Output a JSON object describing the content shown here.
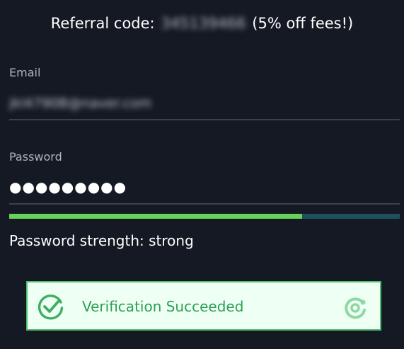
{
  "referral": {
    "prefix": "Referral code:",
    "code": "345139466",
    "suffix": "(5% off fees!)"
  },
  "email": {
    "label": "Email",
    "value": "jkl4790B@naver.com"
  },
  "password": {
    "label": "Password",
    "value": "●●●●●●●●●",
    "strength_fraction": 0.75,
    "strength_text": "Password strength: strong"
  },
  "captcha": {
    "status": "Verification Succeeded",
    "icons": {
      "check": "check-circle-icon",
      "logo": "captcha-logo-icon"
    }
  },
  "colors": {
    "background": "#141923",
    "strength_fill": "#68d15a",
    "strength_track": "#1e5060",
    "captcha_bg": "#eefff3",
    "captcha_accent": "#4fbe6c"
  }
}
